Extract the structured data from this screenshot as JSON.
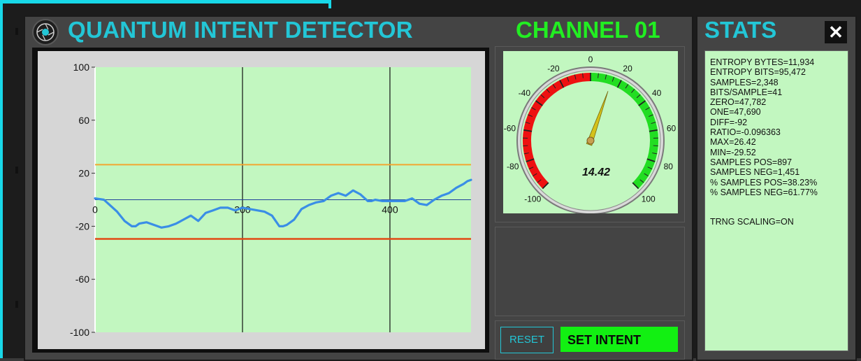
{
  "app": {
    "title": "QUANTUM INTENT DETECTOR",
    "channel": "CHANNEL 01",
    "close_label": "✕"
  },
  "stats": {
    "title": "STATS",
    "lines": [
      "ENTROPY BYTES=11,934",
      "ENTROPY BITS=95,472",
      "SAMPLES=2,348",
      "BITS/SAMPLE=41",
      "ZERO=47,782",
      "ONE=47,690",
      "DIFF=-92",
      "RATIO=-0.096363",
      "MAX=26.42",
      "MIN=-29.52",
      "SAMPLES POS=897",
      "SAMPLES NEG=1,451",
      "% SAMPLES POS=38.23%",
      "% SAMPLES NEG=61.77%"
    ],
    "scaling_line": "TRNG SCALING=ON"
  },
  "gauge": {
    "value_label": "14.42",
    "value": 14.42,
    "min": -100,
    "max": 100,
    "tick_labels": [
      -100,
      -80,
      -60,
      -40,
      -20,
      0,
      20,
      40,
      60,
      80,
      100
    ],
    "negative_color": "#ee1111",
    "positive_color": "#22dd22"
  },
  "controls": {
    "reset_label": "RESET",
    "set_intent_label": "SET INTENT"
  },
  "colors": {
    "accent": "#23c6d6",
    "channel": "#22ee22",
    "plot_bg": "#c2f7c0",
    "series": "#3a8ee6",
    "upper_threshold": "#f2a630",
    "lower_threshold": "#e24a14"
  },
  "chart_data": {
    "type": "line",
    "title": "",
    "xlabel": "",
    "ylabel": "",
    "xlim": [
      0,
      510
    ],
    "ylim": [
      -100,
      100
    ],
    "x_ticks": [
      0,
      200,
      400
    ],
    "y_ticks": [
      100,
      60,
      20,
      -20,
      -60,
      -100
    ],
    "grid_x": [
      200,
      400
    ],
    "thresholds": [
      26.42,
      -29.52
    ],
    "series": [
      {
        "x": [
          0,
          12,
          20,
          30,
          40,
          50,
          55,
          60,
          70,
          80,
          90,
          100,
          110,
          120,
          130,
          140,
          150,
          160,
          170,
          180,
          190,
          200,
          210,
          220,
          230,
          240,
          250,
          255,
          260,
          270,
          280,
          290,
          300,
          310,
          320,
          330,
          340,
          350,
          360,
          370,
          375,
          380,
          390,
          400,
          410,
          420,
          430,
          440,
          450,
          460,
          470,
          480,
          490,
          500,
          505,
          510
        ],
        "y": [
          1,
          0,
          -4,
          -9,
          -16,
          -20,
          -20,
          -18,
          -17,
          -19,
          -21,
          -20,
          -18,
          -15,
          -12,
          -16,
          -10,
          -8,
          -6,
          -6,
          -8,
          -6,
          -7,
          -8,
          -9,
          -12,
          -20,
          -20,
          -19,
          -15,
          -7,
          -4,
          -2,
          -1,
          3,
          5,
          3,
          7,
          4,
          -1,
          -1,
          0,
          -1,
          -1,
          -1,
          -1,
          1,
          -3,
          -4,
          0,
          3,
          5,
          9,
          12,
          14,
          15
        ]
      }
    ]
  }
}
